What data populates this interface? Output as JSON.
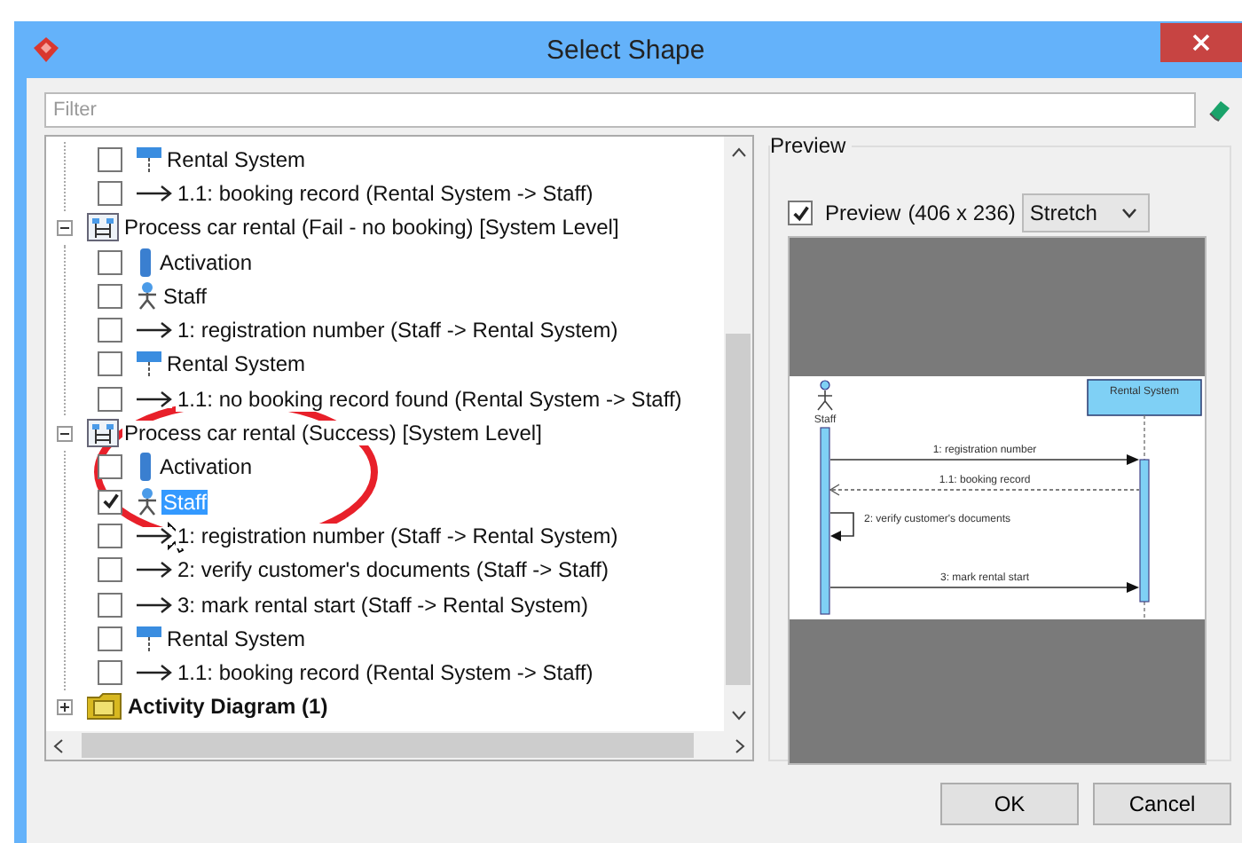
{
  "window": {
    "title": "Select Shape"
  },
  "filter": {
    "placeholder": "Filter"
  },
  "tree": {
    "items": [
      {
        "children": [
          {
            "children": [
              {
                "kind": "lifeline",
                "label": "Rental System",
                "checked": false,
                "selected": false
              },
              {
                "kind": "message",
                "label": "1.1: booking record (Rental System -> Staff)",
                "checked": false,
                "selected": false
              }
            ]
          },
          {
            "kind": "diagram",
            "label": "Process car rental (Fail - no booking) [System Level]",
            "expanded": true,
            "children": [
              {
                "kind": "activation",
                "label": "Activation",
                "checked": false,
                "selected": false
              },
              {
                "kind": "actor",
                "label": "Staff",
                "checked": false,
                "selected": false
              },
              {
                "kind": "message",
                "label": "1: registration number (Staff -> Rental System)",
                "checked": false,
                "selected": false
              },
              {
                "kind": "lifeline",
                "label": "Rental System",
                "checked": false,
                "selected": false
              },
              {
                "kind": "message",
                "label": "1.1: no booking record found (Rental System -> Staff)",
                "checked": false,
                "selected": false
              }
            ]
          },
          {
            "kind": "diagram",
            "label": "Process car rental (Success) [System Level]",
            "expanded": true,
            "children": [
              {
                "kind": "activation",
                "label": "Activation",
                "checked": false,
                "selected": false
              },
              {
                "kind": "actor",
                "label": "Staff",
                "checked": true,
                "selected": true
              },
              {
                "kind": "message",
                "label": "1: registration number (Staff -> Rental System)",
                "checked": false,
                "selected": false
              },
              {
                "kind": "message",
                "label": "2: verify customer's documents (Staff -> Staff)",
                "checked": false,
                "selected": false
              },
              {
                "kind": "message",
                "label": "3: mark rental start (Staff -> Rental System)",
                "checked": false,
                "selected": false
              },
              {
                "kind": "lifeline",
                "label": "Rental System",
                "checked": false,
                "selected": false
              },
              {
                "kind": "message",
                "label": "1.1: booking record (Rental System -> Staff)",
                "checked": false,
                "selected": false
              }
            ]
          }
        ]
      },
      {
        "kind": "folder",
        "label": "Activity Diagram (1)",
        "expanded": false
      }
    ]
  },
  "preview": {
    "group_label": "Preview",
    "checkbox_label": "Preview",
    "checked": true,
    "size": "(406 x 236)",
    "scale_mode": "Stretch",
    "diagram": {
      "actor": "Staff",
      "lifeline": "Rental System",
      "messages": [
        {
          "kind": "call",
          "label": "1: registration number"
        },
        {
          "kind": "return",
          "label": "1.1: booking record"
        },
        {
          "kind": "self",
          "label": "2: verify customer's documents"
        },
        {
          "kind": "call",
          "label": "3: mark rental start"
        }
      ]
    }
  },
  "buttons": [
    {
      "label": "OK"
    },
    {
      "label": "Cancel"
    }
  ]
}
